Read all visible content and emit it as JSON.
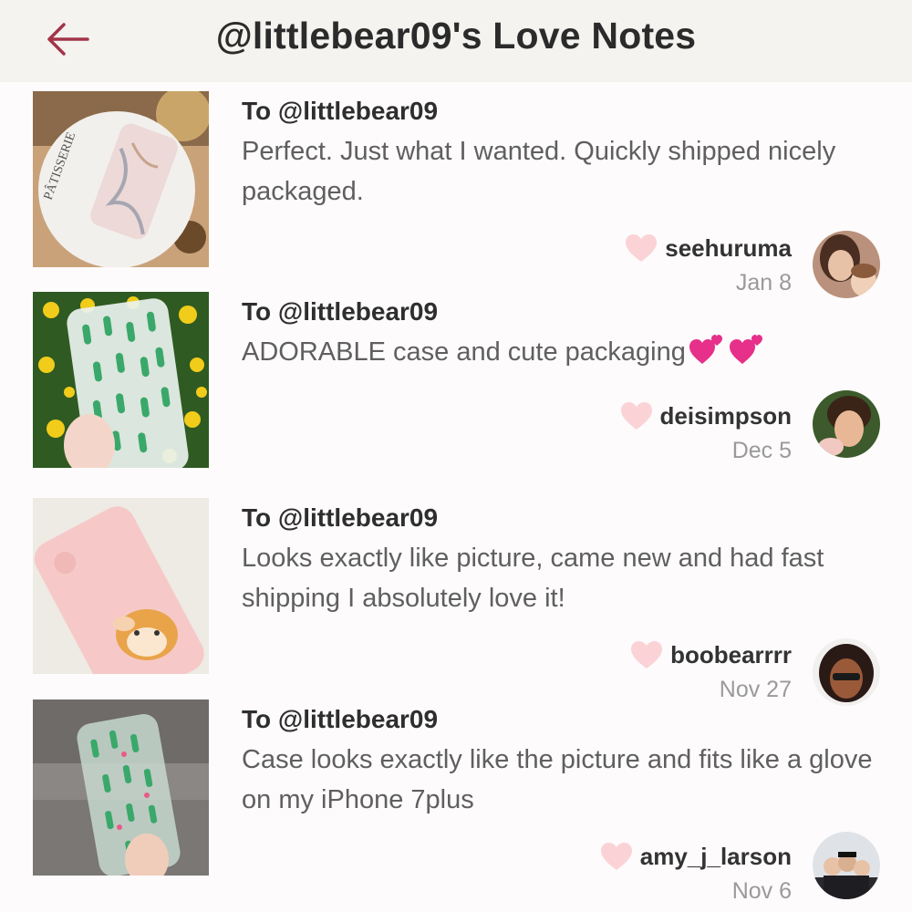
{
  "header": {
    "title": "@littlebear09's Love Notes",
    "back_icon": "left-arrow-icon",
    "accent_color": "#a3344a",
    "background": "#f4f3ef"
  },
  "heart_icon": "heart-icon",
  "heart_color": "#fbd3d7",
  "notes": [
    {
      "to": "To @littlebear09",
      "message": "Perfect. Just what I wanted. Quickly shipped nicely packaged.",
      "user": "seehuruma",
      "date": "Jan 8",
      "photo_text": "PÂTISSERIE"
    },
    {
      "to": "To @littlebear09",
      "message": "ADORABLE case and cute packaging",
      "emoji": "💕💕",
      "user": "deisimpson",
      "date": "Dec 5"
    },
    {
      "to": "To @littlebear09",
      "message": "Looks exactly like picture, came new and had fast shipping I absolutely love it!",
      "user": "boobearrrr",
      "date": "Nov 27"
    },
    {
      "to": "To @littlebear09",
      "message": "Case looks exactly like the picture and fits like a glove on my iPhone 7plus",
      "user": "amy_j_larson",
      "date": "Nov 6"
    }
  ]
}
